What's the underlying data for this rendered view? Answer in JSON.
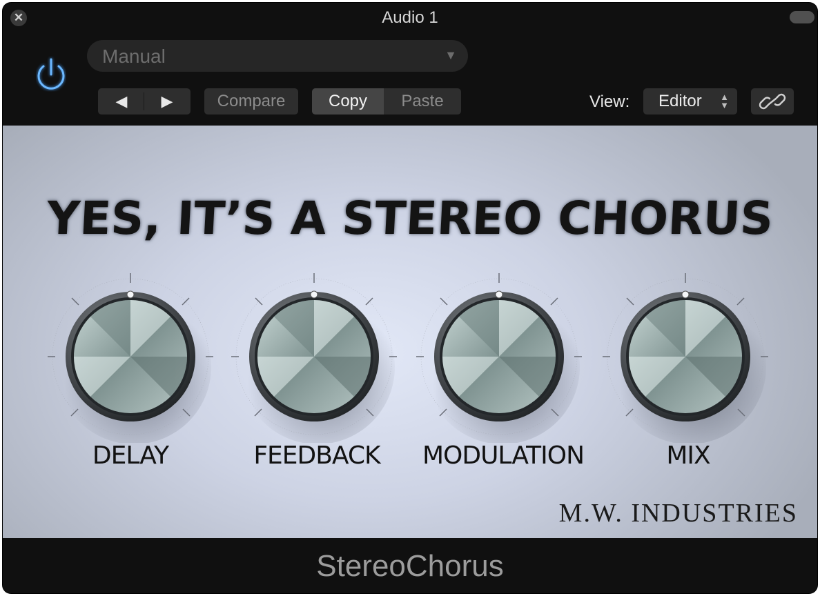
{
  "window": {
    "title": "Audio 1"
  },
  "toolbar": {
    "preset_value": "Manual",
    "prev_symbol": "◀",
    "next_symbol": "▶",
    "compare_label": "Compare",
    "copy_label": "Copy",
    "paste_label": "Paste",
    "view_label": "View:",
    "view_value": "Editor"
  },
  "plugin": {
    "headline": "YES, IT’S A STEREO CHORUS",
    "knobs": [
      {
        "label": "DELAY"
      },
      {
        "label": "FEEDBACK"
      },
      {
        "label": "MODULATION"
      },
      {
        "label": "MIX"
      }
    ],
    "brand": "M.W. INDUSTRIES"
  },
  "footer": {
    "plugin_name": "StereoChorus"
  },
  "colors": {
    "power_accent": "#4aa3ff",
    "panel": "#d6dcec",
    "chrome": "#101010"
  }
}
